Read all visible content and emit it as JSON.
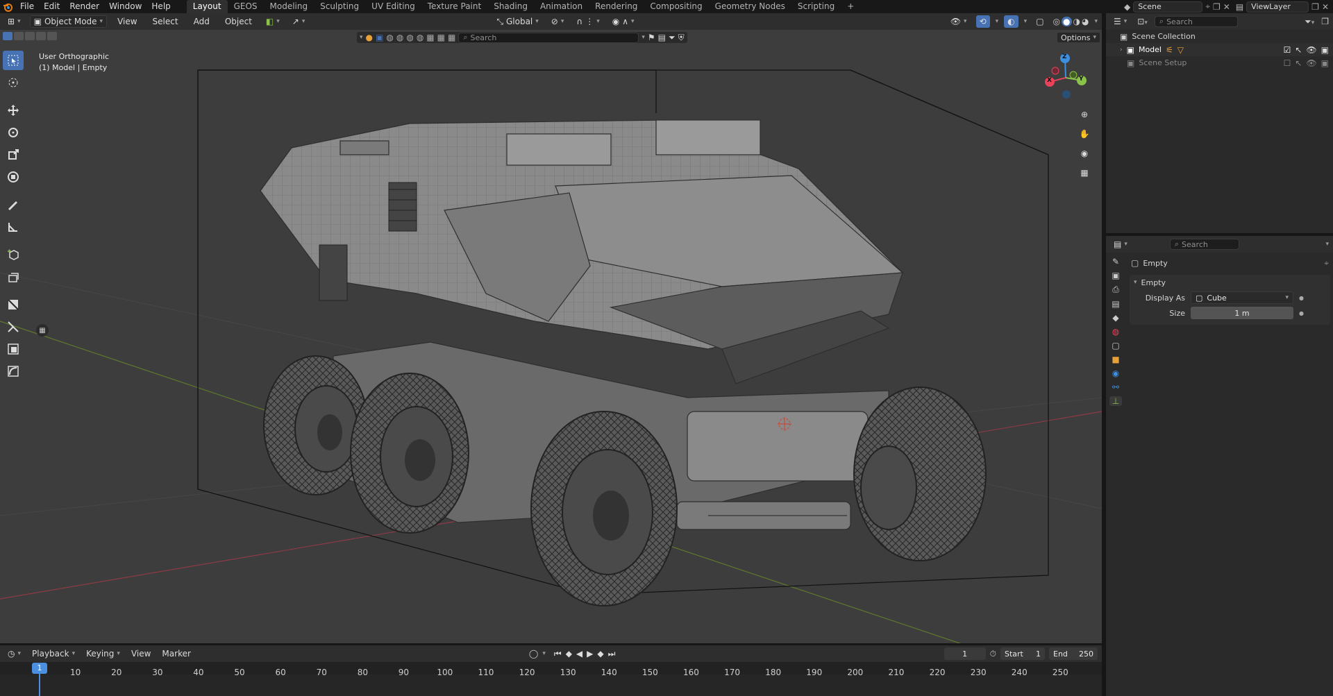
{
  "menu": {
    "app_icon": "blender-icon",
    "items": [
      "File",
      "Edit",
      "Render",
      "Window",
      "Help"
    ]
  },
  "workspaces": [
    "Layout",
    "GEOS",
    "Modeling",
    "Sculpting",
    "UV Editing",
    "Texture Paint",
    "Shading",
    "Animation",
    "Rendering",
    "Compositing",
    "Geometry Nodes",
    "Scripting"
  ],
  "active_workspace": "Layout",
  "scene": {
    "name": "Scene",
    "view_layer": "ViewLayer"
  },
  "viewport_header": {
    "mode": "Object Mode",
    "menus": [
      "View",
      "Select",
      "Add",
      "Object"
    ],
    "transform_orientation": "Global",
    "options": "Options"
  },
  "asset_search": {
    "placeholder": "Search"
  },
  "overlay_text": {
    "view": "User Orthographic",
    "object": "(1) Model | Empty"
  },
  "gizmo": {
    "x": "X",
    "y": "Y",
    "z": "Z"
  },
  "outliner": {
    "search_placeholder": "Search",
    "root": "Scene Collection",
    "items": [
      "Model",
      "Scene Setup"
    ]
  },
  "properties": {
    "search_placeholder": "Search",
    "object_name": "Empty",
    "panel_title": "Empty",
    "display_as_label": "Display As",
    "display_as_value": "Cube",
    "size_label": "Size",
    "size_value": "1 m"
  },
  "timeline": {
    "menus": [
      "Playback",
      "Keying",
      "View",
      "Marker"
    ],
    "current_frame": "1",
    "start_label": "Start",
    "start_value": "1",
    "end_label": "End",
    "end_value": "250",
    "ticks": [
      "1",
      "10",
      "20",
      "30",
      "40",
      "50",
      "60",
      "70",
      "80",
      "90",
      "100",
      "110",
      "120",
      "130",
      "140",
      "150",
      "160",
      "170",
      "180",
      "190",
      "200",
      "210",
      "220",
      "230",
      "240",
      "250"
    ]
  },
  "colors": {
    "accent": "#4772b3",
    "axis_x": "#e8435a",
    "axis_y": "#8bc34a",
    "axis_z": "#3d8fe0",
    "playhead": "#4a8fe0"
  }
}
